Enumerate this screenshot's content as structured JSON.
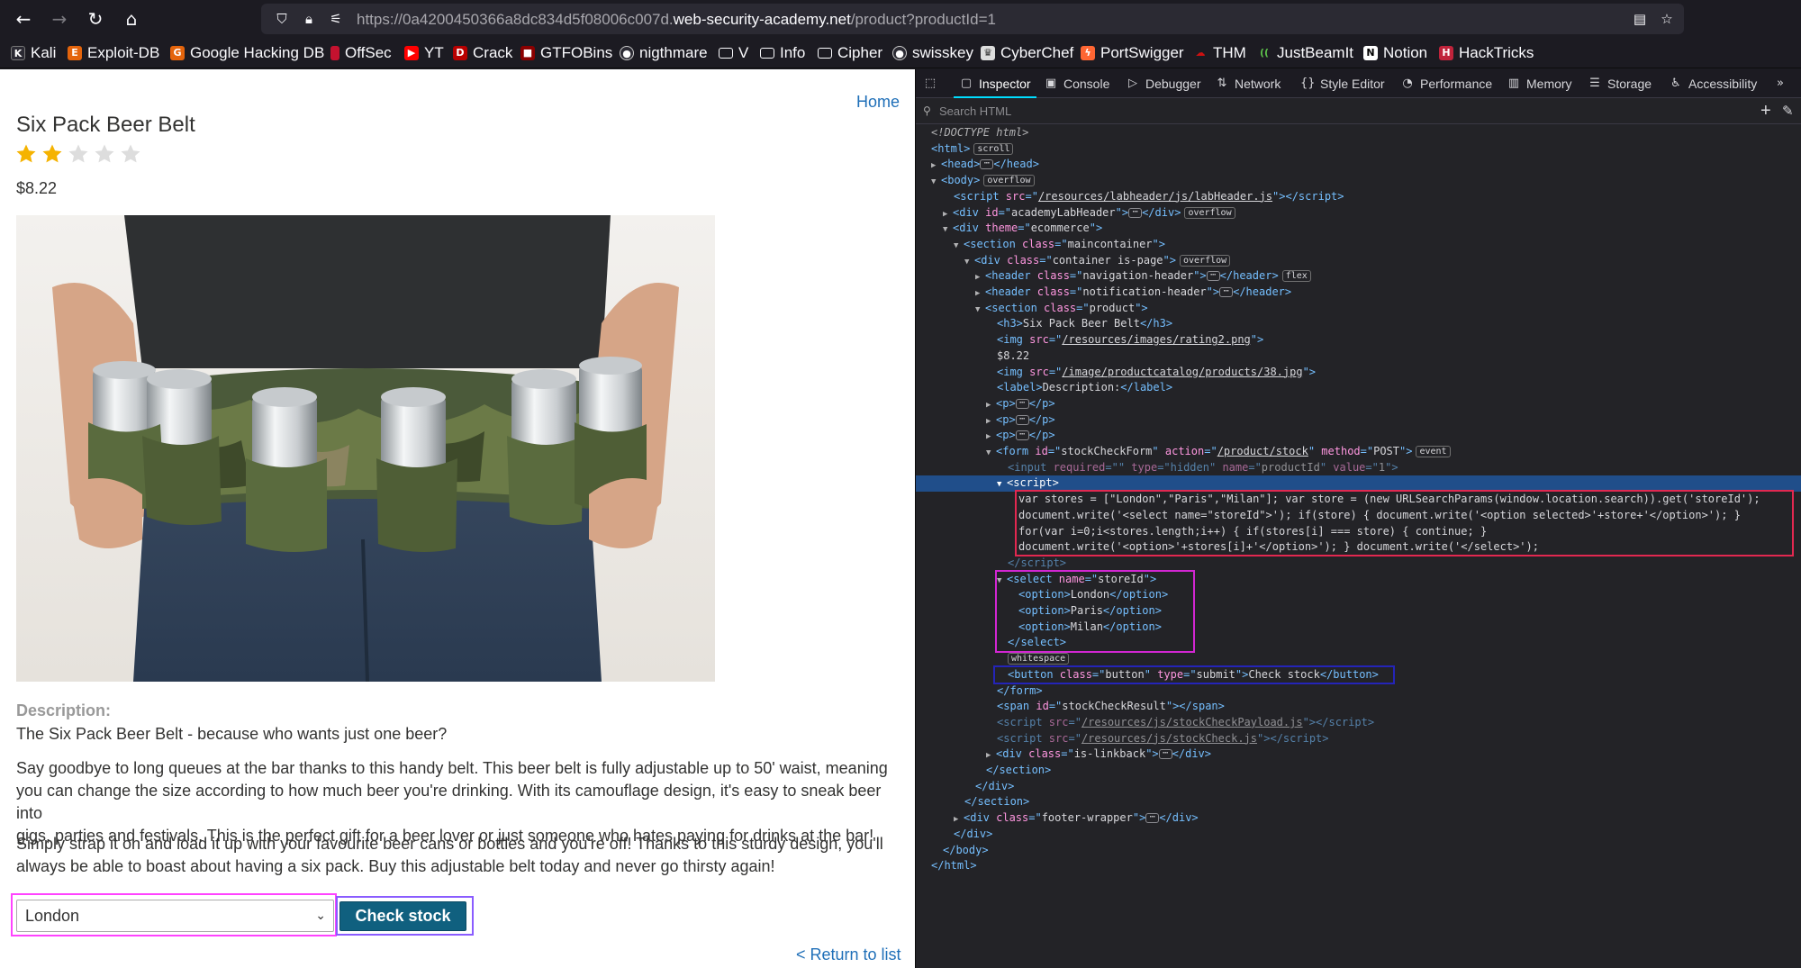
{
  "browser": {
    "url_prefix": "https://0a4200450366a8dc834d5f08006c007d.",
    "url_host": "web-security-academy.net",
    "url_path": "/product?productId=1",
    "bookmarks": [
      "Kali",
      "Exploit-DB",
      "Google Hacking DB",
      "OffSec",
      "YT",
      "Crack",
      "GTFOBins",
      "nigthmare",
      "V",
      "Info",
      "Cipher",
      "swisskey",
      "CyberChef",
      "PortSwigger",
      "THM",
      "JustBeamIt",
      "Notion",
      "HackTricks"
    ]
  },
  "page": {
    "home_link": "Home",
    "title": "Six Pack Beer Belt",
    "rating": 2,
    "rating_max": 5,
    "price": "$8.22",
    "description_label": "Description:",
    "description_lines": [
      "The Six Pack Beer Belt - because who wants just one beer?",
      "Say goodbye to long queues at the bar thanks to this handy belt. This beer belt is fully adjustable up to 50' waist, meaning",
      "you can change the size according to how much beer you're drinking. With its camouflage design, it's easy to sneak beer into",
      "gigs, parties and festivals. This is the perfect gift for a beer lover or just someone who hates paying for drinks at the bar!",
      "Simply strap it on and load it up with your favourite beer cans or bottles and you're off! Thanks to this sturdy design, you'll",
      "always be able to boast about having a six pack. Buy this adjustable belt today and never go thirsty again!"
    ],
    "store_selected": "London",
    "check_stock_label": "Check stock",
    "return_link": "< Return to list"
  },
  "devtools": {
    "tabs": [
      "Inspector",
      "Console",
      "Debugger",
      "Network",
      "Style Editor",
      "Performance",
      "Memory",
      "Storage",
      "Accessibility"
    ],
    "active_tab": "Inspector",
    "search_placeholder": "Search HTML",
    "badges": {
      "scroll": "scroll",
      "overflow": "overflow",
      "flex": "flex",
      "event": "event",
      "whitespace": "whitespace"
    },
    "script_lines": [
      "var stores = [\"London\",\"Paris\",\"Milan\"]; var store = (new URLSearchParams(window.location.search)).get('storeId');",
      "document.write('<select name=\"storeId\">'); if(store) { document.write('<option selected>'+store+'</option>'); }",
      "for(var i=0;i<stores.length;i++) { if(stores[i] === store) { continue; }",
      "document.write('<option>'+stores[i]+'</option>'); } document.write('</select>');"
    ],
    "options": [
      "London",
      "Paris",
      "Milan"
    ],
    "strings": {
      "doctype": "<!DOCTYPE html>",
      "labheader_src": "/resources/labheader/js/labHeader.js",
      "academy_id": "academyLabHeader",
      "theme": "ecommerce",
      "maincontainer": "maincontainer",
      "container": "container is-page",
      "nav_header": "navigation-header",
      "notif_header": "notification-header",
      "product": "product",
      "h3_text": "Six Pack Beer Belt",
      "rating_src": "/resources/images/rating2.png",
      "price": "$8.22",
      "product_img": "/image/productcatalog/products/38.jpg",
      "label_text": "Description:",
      "form_id": "stockCheckForm",
      "form_action": "/product/stock",
      "form_method": "POST",
      "input_name": "productId",
      "input_value": "1",
      "select_name": "storeId",
      "button_class": "button",
      "button_type": "submit",
      "button_text": "Check stock",
      "result_id": "stockCheckResult",
      "payload_src": "/resources/js/stockCheckPayload.js",
      "check_src": "/resources/js/stockCheck.js",
      "linkback": "is-linkback",
      "footer": "footer-wrapper"
    }
  }
}
